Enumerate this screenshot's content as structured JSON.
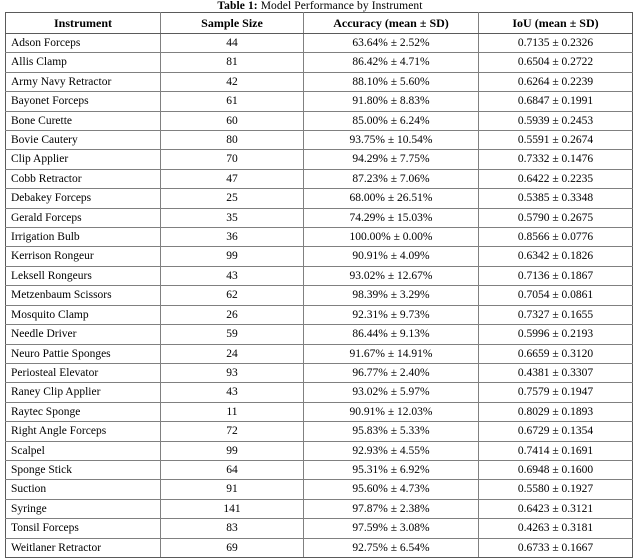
{
  "caption": {
    "label": "Table 1:",
    "text": "Model Performance by Instrument"
  },
  "table": {
    "columns": [
      "Instrument",
      "Sample Size",
      "Accuracy (mean ± SD)",
      "IoU (mean ± SD)"
    ],
    "rows": [
      [
        "Adson Forceps",
        "44",
        "63.64% ± 2.52%",
        "0.7135 ± 0.2326"
      ],
      [
        "Allis Clamp",
        "81",
        "86.42% ± 4.71%",
        "0.6504 ± 0.2722"
      ],
      [
        "Army Navy Retractor",
        "42",
        "88.10% ± 5.60%",
        "0.6264 ± 0.2239"
      ],
      [
        "Bayonet Forceps",
        "61",
        "91.80% ± 8.83%",
        "0.6847 ± 0.1991"
      ],
      [
        "Bone Curette",
        "60",
        "85.00% ± 6.24%",
        "0.5939 ± 0.2453"
      ],
      [
        "Bovie Cautery",
        "80",
        "93.75% ± 10.54%",
        "0.5591 ± 0.2674"
      ],
      [
        "Clip Applier",
        "70",
        "94.29% ± 7.75%",
        "0.7332 ± 0.1476"
      ],
      [
        "Cobb Retractor",
        "47",
        "87.23% ± 7.06%",
        "0.6422 ± 0.2235"
      ],
      [
        "Debakey Forceps",
        "25",
        "68.00% ± 26.51%",
        "0.5385 ± 0.3348"
      ],
      [
        "Gerald Forceps",
        "35",
        "74.29% ± 15.03%",
        "0.5790 ± 0.2675"
      ],
      [
        "Irrigation Bulb",
        "36",
        "100.00% ± 0.00%",
        "0.8566 ± 0.0776"
      ],
      [
        "Kerrison Rongeur",
        "99",
        "90.91% ± 4.09%",
        "0.6342 ± 0.1826"
      ],
      [
        "Leksell Rongeurs",
        "43",
        "93.02% ± 12.67%",
        "0.7136 ± 0.1867"
      ],
      [
        "Metzenbaum Scissors",
        "62",
        "98.39% ± 3.29%",
        "0.7054 ± 0.0861"
      ],
      [
        "Mosquito Clamp",
        "26",
        "92.31% ± 9.73%",
        "0.7327 ± 0.1655"
      ],
      [
        "Needle Driver",
        "59",
        "86.44% ± 9.13%",
        "0.5996 ± 0.2193"
      ],
      [
        "Neuro Pattie Sponges",
        "24",
        "91.67% ± 14.91%",
        "0.6659 ± 0.3120"
      ],
      [
        "Periosteal Elevator",
        "93",
        "96.77% ± 2.40%",
        "0.4381 ± 0.3307"
      ],
      [
        "Raney Clip Applier",
        "43",
        "93.02% ± 5.97%",
        "0.7579 ± 0.1947"
      ],
      [
        "Raytec Sponge",
        "11",
        "90.91% ± 12.03%",
        "0.8029 ± 0.1893"
      ],
      [
        "Right Angle Forceps",
        "72",
        "95.83% ± 5.33%",
        "0.6729 ± 0.1354"
      ],
      [
        "Scalpel",
        "99",
        "92.93% ± 4.55%",
        "0.7414 ± 0.1691"
      ],
      [
        "Sponge Stick",
        "64",
        "95.31% ± 6.92%",
        "0.6948 ± 0.1600"
      ],
      [
        "Suction",
        "91",
        "95.60% ± 4.73%",
        "0.5580 ± 0.1927"
      ],
      [
        "Syringe",
        "141",
        "97.87% ± 2.38%",
        "0.6423 ± 0.3121"
      ],
      [
        "Tonsil Forceps",
        "83",
        "97.59% ± 3.08%",
        "0.4263 ± 0.3181"
      ],
      [
        "Weitlaner Retractor",
        "69",
        "92.75% ± 6.54%",
        "0.6733 ± 0.1667"
      ]
    ]
  },
  "colors": {
    "text": "#000000",
    "border": "#808080",
    "border_strong": "#5a5a5a",
    "background": "#ffffff"
  }
}
